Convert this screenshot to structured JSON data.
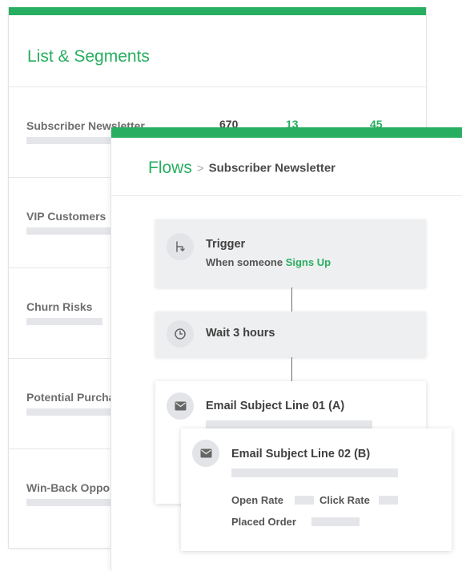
{
  "theme": {
    "accent": "#27ae60"
  },
  "segments": {
    "title": "List & Segments",
    "rows": [
      {
        "name": "Subscriber Newsletter",
        "stats": [
          "670",
          "13",
          "45"
        ]
      },
      {
        "name": "VIP Customers"
      },
      {
        "name": "Churn Risks"
      },
      {
        "name": "Potential Purchasers"
      },
      {
        "name": "Win-Back Opportunities"
      }
    ]
  },
  "flows": {
    "breadcrumb_root": "Flows",
    "breadcrumb_separator": ">",
    "breadcrumb_current": "Subscriber Newsletter",
    "trigger": {
      "icon": "branch-icon",
      "title": "Trigger",
      "subtitle_prefix": "When someone ",
      "subtitle_highlight": "Signs Up"
    },
    "wait": {
      "icon": "clock-icon",
      "title": "Wait 3 hours"
    },
    "email_a": {
      "icon": "envelope-icon",
      "title": "Email Subject Line 01 (A)"
    },
    "email_b": {
      "icon": "envelope-icon",
      "title": "Email Subject Line 02 (B)",
      "open_rate_label": "Open Rate",
      "click_rate_label": "Click Rate",
      "placed_order_label": "Placed Order"
    }
  }
}
